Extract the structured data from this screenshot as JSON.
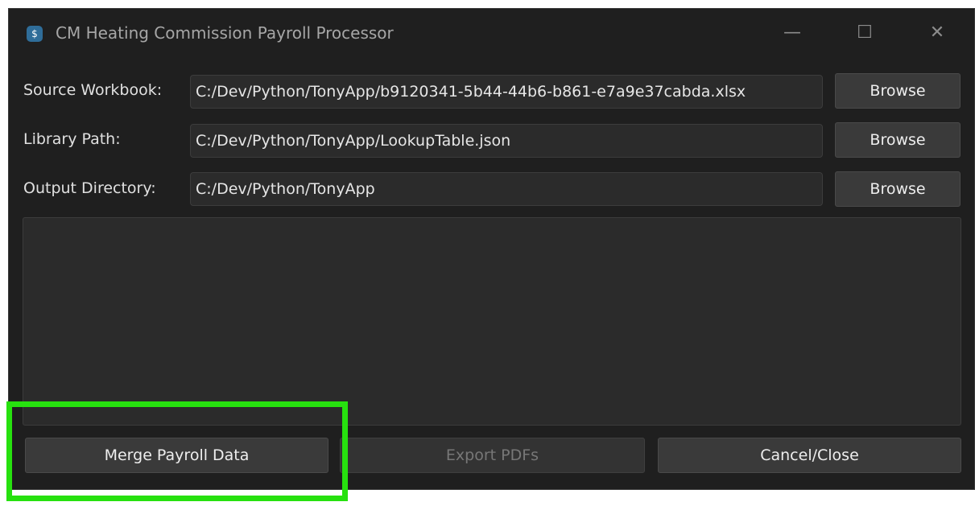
{
  "window": {
    "title": "CM Heating Commission Payroll Processor",
    "app_icon_glyph": "$",
    "controls": {
      "minimize": "—",
      "maximize": "☐",
      "close": "✕"
    }
  },
  "fields": [
    {
      "label": "Source Workbook:",
      "value": "C:/Dev/Python/TonyApp/b9120341-5b44-44b6-b861-e7a9e37cabda.xlsx",
      "button": "Browse"
    },
    {
      "label": "Library Path:",
      "value": "C:/Dev/Python/TonyApp/LookupTable.json",
      "button": "Browse"
    },
    {
      "label": "Output Directory:",
      "value": "C:/Dev/Python/TonyApp",
      "button": "Browse"
    }
  ],
  "log": {
    "text": ""
  },
  "actions": {
    "merge_label": "Merge Payroll Data",
    "export_label": "Export PDFs",
    "cancel_label": "Cancel/Close"
  },
  "colors": {
    "window_bg": "#1f1f1f",
    "field_bg": "#2b2b2b",
    "button_bg": "#3a3a3a",
    "highlight": "#27e10f"
  }
}
